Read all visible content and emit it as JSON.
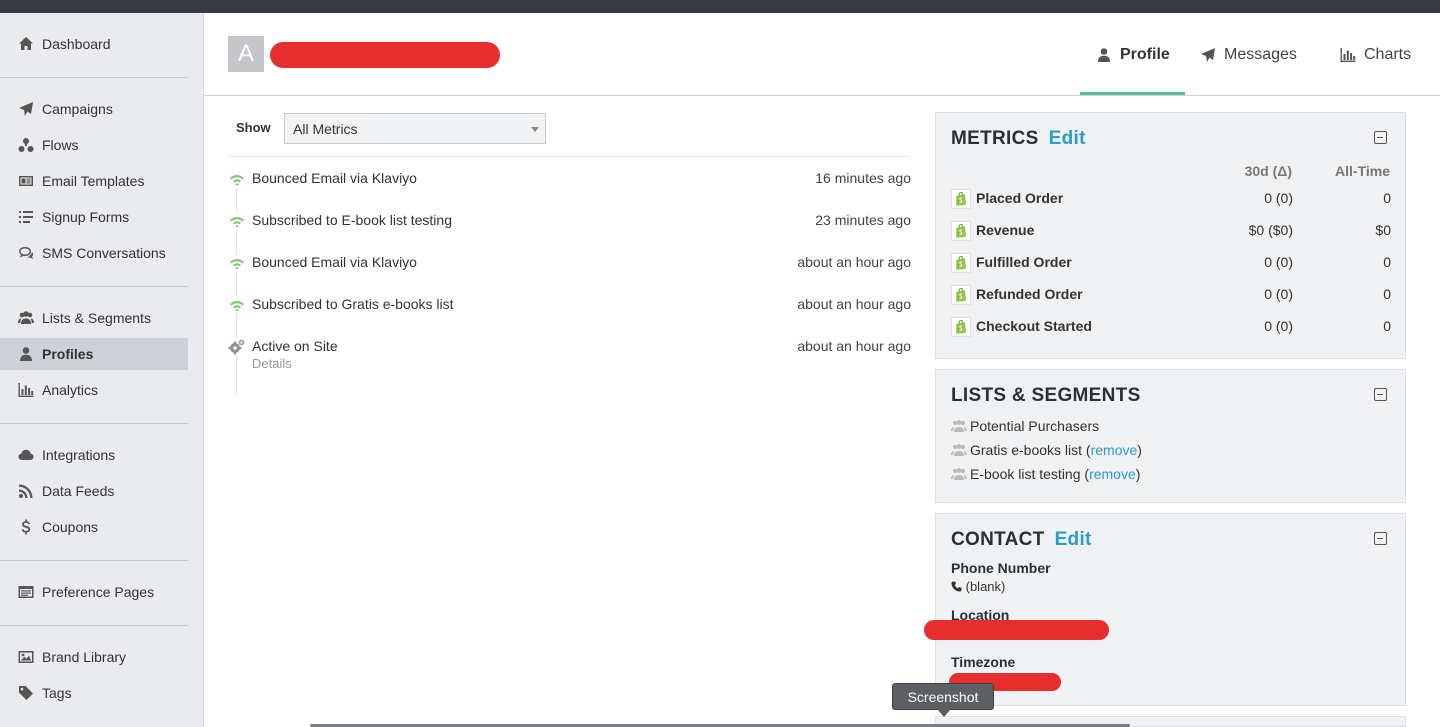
{
  "sidebar": {
    "items": [
      {
        "label": "Dashboard",
        "icon": "home-icon"
      },
      {
        "label": "Campaigns",
        "icon": "paper-plane-icon"
      },
      {
        "label": "Flows",
        "icon": "flows-icon"
      },
      {
        "label": "Email Templates",
        "icon": "template-icon"
      },
      {
        "label": "Signup Forms",
        "icon": "form-list-icon"
      },
      {
        "label": "SMS Conversations",
        "icon": "chat-icon"
      },
      {
        "label": "Lists & Segments",
        "icon": "users-icon"
      },
      {
        "label": "Profiles",
        "icon": "user-icon"
      },
      {
        "label": "Analytics",
        "icon": "bar-chart-icon"
      },
      {
        "label": "Integrations",
        "icon": "cloud-icon"
      },
      {
        "label": "Data Feeds",
        "icon": "rss-icon"
      },
      {
        "label": "Coupons",
        "icon": "dollar-icon"
      },
      {
        "label": "Preference Pages",
        "icon": "preference-page-icon"
      },
      {
        "label": "Brand Library",
        "icon": "image-icon"
      },
      {
        "label": "Tags",
        "icon": "tag-icon"
      }
    ]
  },
  "header": {
    "avatar_letter": "A",
    "tabs": [
      {
        "label": "Profile",
        "icon": "user-icon"
      },
      {
        "label": "Messages",
        "icon": "paper-plane-icon"
      },
      {
        "label": "Charts",
        "icon": "bar-chart-icon"
      }
    ]
  },
  "feed": {
    "show_label": "Show",
    "filter_value": "All Metrics",
    "events": [
      {
        "text": "Bounced Email via Klaviyo",
        "time": "16 minutes ago",
        "icon": "email-signal-icon"
      },
      {
        "text": "Subscribed to E-book list testing",
        "time": "23 minutes ago",
        "icon": "email-signal-icon"
      },
      {
        "text": "Bounced Email via Klaviyo",
        "time": "about an hour ago",
        "icon": "email-signal-icon"
      },
      {
        "text": "Subscribed to Gratis e-books list",
        "time": "about an hour ago",
        "icon": "email-signal-icon"
      },
      {
        "text": "Active on Site",
        "time": "about an hour ago",
        "detail": "Details",
        "icon": "gears-icon"
      }
    ]
  },
  "metrics": {
    "title": "METRICS",
    "edit": "Edit",
    "col_30d": "30d (Δ)",
    "col_all": "All-Time",
    "rows": [
      {
        "name": "Placed Order",
        "d30": "0 (0)",
        "all": "0"
      },
      {
        "name": "Revenue",
        "d30": "$0 ($0)",
        "all": "$0"
      },
      {
        "name": "Fulfilled Order",
        "d30": "0 (0)",
        "all": "0"
      },
      {
        "name": "Refunded Order",
        "d30": "0 (0)",
        "all": "0"
      },
      {
        "name": "Checkout Started",
        "d30": "0 (0)",
        "all": "0"
      }
    ]
  },
  "lists": {
    "title": "LISTS & SEGMENTS",
    "remove_label": "remove",
    "items": [
      {
        "name": "Potential Purchasers"
      },
      {
        "name": "Gratis e-books list"
      },
      {
        "name": "E-book list testing"
      }
    ]
  },
  "contact": {
    "title": "CONTACT",
    "edit": "Edit",
    "phone_label": "Phone Number",
    "phone_value": "(blank)",
    "location_label": "Location",
    "timezone_label": "Timezone"
  },
  "tooltip": {
    "label": "Screenshot"
  },
  "colors": {
    "accent": "#2a9ec8",
    "tab_underline": "#5bbc8b",
    "redaction": "#e62e2e",
    "sidebar_bg": "#e9ebee"
  }
}
